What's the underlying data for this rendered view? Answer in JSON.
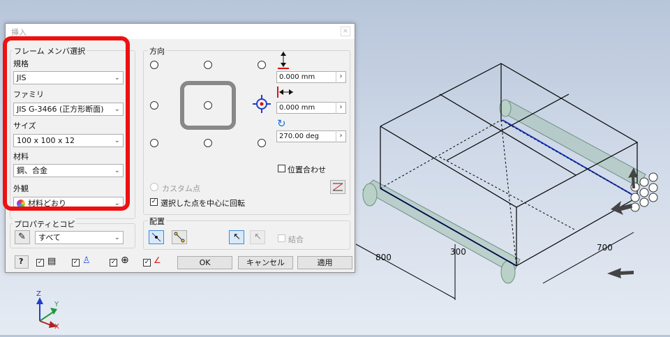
{
  "dialog": {
    "title": "挿入",
    "close_glyph": "×",
    "frame_member": {
      "group_label": "フレーム メンバ選択",
      "standard_label": "規格",
      "standard_value": "JIS",
      "family_label": "ファミリ",
      "family_value": "JIS G-3466 (正方形断面)",
      "size_label": "サイズ",
      "size_value": "100 x 100 x 12",
      "material_label": "材料",
      "material_value": "鋼、合金",
      "appearance_label": "外観",
      "appearance_value": "材料どおり"
    },
    "property": {
      "group_label": "プロパティとコピ",
      "value": "すべて"
    },
    "orientation": {
      "group_label": "方向",
      "offset_y": "0.000 mm",
      "offset_x": "0.000 mm",
      "rotation": "270.00 deg",
      "align_label": "位置合わせ",
      "custom_point_label": "カスタム点",
      "rotate_label": "選択した点を中心に回転"
    },
    "placement": {
      "group_label": "配置",
      "merge_label": "結合"
    },
    "buttons": {
      "ok": "OK",
      "cancel": "キャンセル",
      "apply": "適用"
    }
  },
  "model": {
    "dimensions": {
      "d800": "800",
      "d300": "300",
      "d700": "700"
    }
  },
  "view_axes": {
    "z": "Z",
    "y": "Y",
    "x": "X"
  },
  "colors": {
    "highlight": "#e11111",
    "beam": "#1a3ccf",
    "frame_fill": "#a6c3b6"
  }
}
